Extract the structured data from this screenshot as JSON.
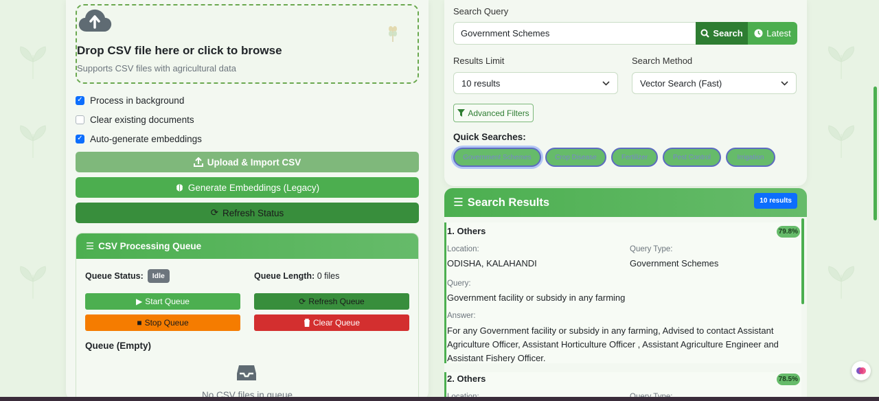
{
  "upload": {
    "drop_title": "Drop CSV file here or click to browse",
    "drop_subtitle": "Supports CSV files with agricultural data",
    "options": [
      {
        "label": "Process in background",
        "checked": true
      },
      {
        "label": "Clear existing documents",
        "checked": false
      },
      {
        "label": "Auto-generate embeddings",
        "checked": true
      }
    ],
    "upload_button": "Upload & Import CSV",
    "embeddings_button": "Generate Embeddings (Legacy)",
    "refresh_button": "Refresh Status"
  },
  "queue": {
    "title": "CSV Processing Queue",
    "status_label": "Queue Status:",
    "status_value": "Idle",
    "length_label": "Queue Length:",
    "length_value": "0 files",
    "start_button": "Start Queue",
    "refresh_button": "Refresh Queue",
    "stop_button": "Stop Queue",
    "clear_button": "Clear Queue",
    "empty_title": "Queue (Empty)",
    "empty_text": "No CSV files in queue"
  },
  "search": {
    "query_label": "Search Query",
    "query_value": "Government Schemes",
    "search_button": "Search",
    "latest_button": "Latest",
    "limit_label": "Results Limit",
    "limit_value": "10 results",
    "method_label": "Search Method",
    "method_value": "Vector Search (Fast)",
    "advanced_filters": "Advanced Filters",
    "quick_label": "Quick Searches:",
    "quick": [
      "Government Schemes",
      "Crop Disease",
      "Fertilizer",
      "Pest Control",
      "Irrigation"
    ]
  },
  "results": {
    "title": "Search Results",
    "count": "10 results",
    "items": [
      {
        "title": "1. Others",
        "score": "79.8%",
        "location_label": "Location:",
        "location": "ODISHA, KALAHANDI",
        "type_label": "Query Type:",
        "type": "Government Schemes",
        "query_label": "Query:",
        "query": "Government facility or subsidy in any farming",
        "answer_label": "Answer:",
        "answer": "For any Government facility or subsidy in any farming, Advised to contact Assistant Agriculture Officer, Assistant Horticulture Officer , Assistant Agriculture Engineer and Assistant Fishery Officer."
      },
      {
        "title": "2. Others",
        "score": "78.5%",
        "location_label": "Location:",
        "type_label": "Query Type:"
      }
    ]
  },
  "colors": {
    "primary_green": "#4caf50",
    "dark_green": "#2e7d32",
    "accent_blue": "#0d6efd",
    "warning_orange": "#f57c00",
    "danger_red": "#d32f2f"
  }
}
